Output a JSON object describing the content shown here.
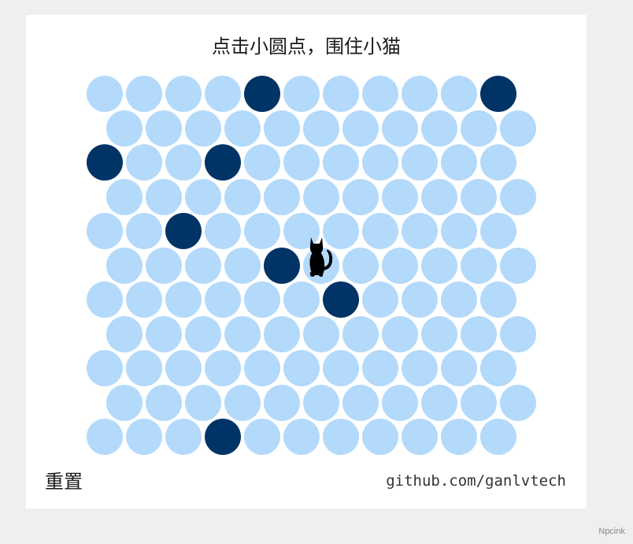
{
  "title": "点击小圆点，围住小猫",
  "reset_label": "重置",
  "credit": "github.com/ganlvtech",
  "watermark": "Npcink",
  "board": {
    "columns": 11,
    "rows": 11,
    "walls": [
      [
        0,
        4
      ],
      [
        0,
        10
      ],
      [
        2,
        0
      ],
      [
        2,
        3
      ],
      [
        4,
        2
      ],
      [
        5,
        4
      ],
      [
        6,
        6
      ],
      [
        10,
        3
      ]
    ],
    "cat": [
      5,
      5
    ]
  },
  "colors": {
    "empty_dot": "#b3d9fb",
    "wall_dot": "#003366",
    "background": "#efefef",
    "card": "#ffffff"
  }
}
